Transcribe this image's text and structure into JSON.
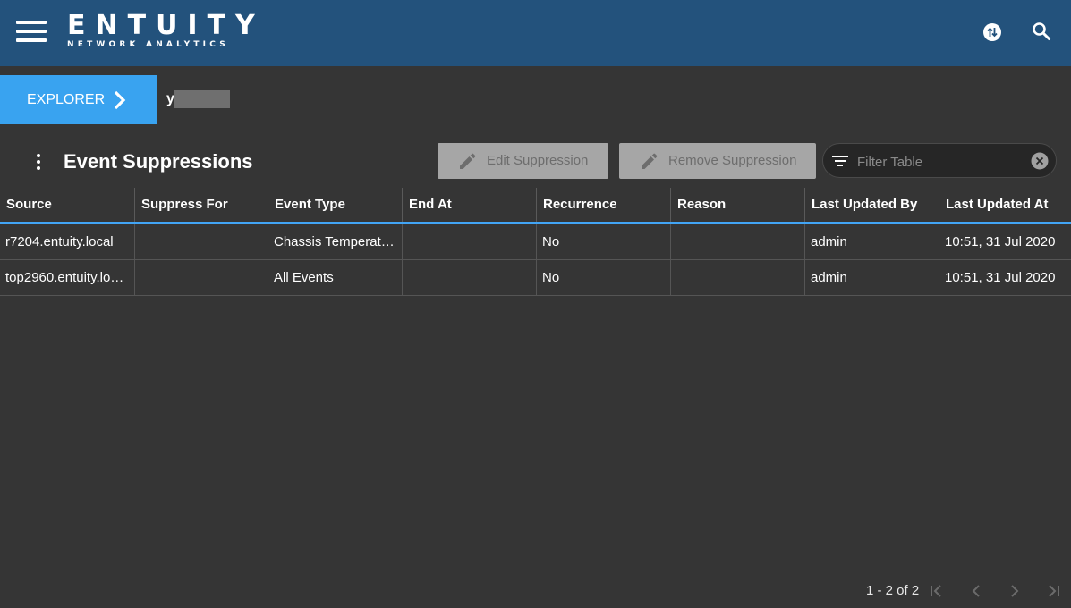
{
  "header": {
    "logo_main": "ENTUITY",
    "logo_sub": "NETWORK ANALYTICS",
    "icons": [
      "menu-icon",
      "swap-icon",
      "search-icon"
    ]
  },
  "breadcrumb": {
    "explorer_label": "EXPLORER",
    "current_item": "y"
  },
  "page": {
    "title": "Event Suppressions"
  },
  "toolbar": {
    "edit_label": "Edit Suppression",
    "remove_label": "Remove Suppression",
    "filter_placeholder": "Filter Table",
    "filter_value": ""
  },
  "table": {
    "columns": [
      "Source",
      "Suppress For",
      "Event Type",
      "End At",
      "Recurrence",
      "Reason",
      "Last Updated By",
      "Last Updated At"
    ],
    "rows": [
      [
        "r7204.entuity.local",
        "",
        "Chassis Temperat…",
        "",
        "No",
        "",
        "admin",
        "10:51, 31 Jul 2020"
      ],
      [
        "top2960.entuity.lo…",
        "",
        "All Events",
        "",
        "No",
        "",
        "admin",
        "10:51, 31 Jul 2020"
      ]
    ]
  },
  "paginator": {
    "range_label": "1 - 2 of 2"
  },
  "colors": {
    "header_bg": "#23527c",
    "body_bg": "#353535",
    "accent": "#39a3f0",
    "disabled_button": "#a6a6a6"
  }
}
